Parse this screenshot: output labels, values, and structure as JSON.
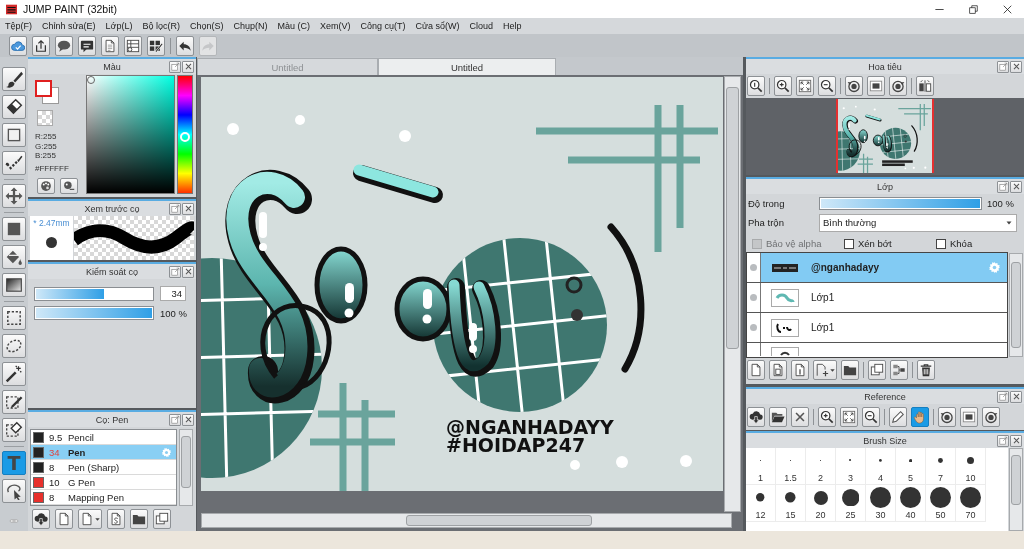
{
  "window": {
    "title": "JUMP PAINT (32bit)"
  },
  "menu": [
    "Tệp(F)",
    "Chỉnh sửa(E)",
    "Lớp(L)",
    "Bộ lọc(R)",
    "Chọn(S)",
    "Chụp(N)",
    "Màu (C)",
    "Xem(V)",
    "Công cụ(T)",
    "Cửa sổ(W)",
    "Cloud",
    "Help"
  ],
  "toolbar": [
    [
      {
        "disabled": false
      },
      {
        "disabled": false
      },
      {
        "disabled": false
      },
      {
        "disabled": false
      },
      {
        "disabled": false
      },
      {
        "disabled": false
      },
      {
        "disabled": false
      }
    ],
    [
      {
        "disabled": false
      },
      {
        "disabled": true
      }
    ]
  ],
  "tools": [
    [
      {
        "selected": false
      },
      {
        "selected": false
      },
      {
        "selected": false
      },
      {
        "selected": false
      }
    ],
    [
      {
        "selected": false
      }
    ],
    [
      {
        "selected": false
      },
      {
        "selected": false
      },
      {
        "selected": false
      }
    ],
    [
      {
        "selected": false
      },
      {
        "selected": false
      },
      {
        "selected": false
      },
      {
        "selected": false
      },
      {
        "selected": false
      }
    ],
    [
      {
        "selected": true,
        "glyph": "T"
      },
      {
        "selected": false
      }
    ]
  ],
  "color_panel": {
    "title": "Màu",
    "channels": [
      "R:255",
      "G:255",
      "B:255"
    ],
    "hex": "#FFFFFF",
    "hue_slider": {
      "level": 0.52
    }
  },
  "brush_preview": {
    "title": "Xem trước cọ",
    "size": "* 2.47mm"
  },
  "brush_control": {
    "title": "Kiểm soát cọ",
    "size_slider": {
      "level": 0.59,
      "reading": "34"
    },
    "opacity_slider": {
      "level": 1,
      "reading": "100 %"
    }
  },
  "brush_list": {
    "title": "Cọ: Pen",
    "brushes": [
      {
        "color": "#222222",
        "size": "9.5",
        "name": "Pencil",
        "selected": false
      },
      {
        "color": "#222222",
        "size": "34",
        "name": "Pen",
        "selected": true
      },
      {
        "color": "#222222",
        "size": "8",
        "name": "Pen (Sharp)",
        "selected": false
      },
      {
        "color": "#e8302c",
        "size": "10",
        "name": "G Pen",
        "selected": false
      },
      {
        "color": "#e8302c",
        "size": "8",
        "name": "Mapping Pen",
        "selected": false
      }
    ]
  },
  "document_tabs": [
    {
      "label": "Untitled",
      "selected": false
    },
    {
      "label": "Untitled",
      "selected": true
    }
  ],
  "canvas": {
    "artwork_text": [
      "@NGANHADAYY",
      "#HOIDAP247"
    ]
  },
  "navigator": {
    "title": "Hoa tiêu"
  },
  "layers": {
    "title": "Lớp",
    "opacity": {
      "label": "Độ trong",
      "level": 1,
      "reading": "100 %"
    },
    "blend": {
      "label": "Pha trộn",
      "value": "Bình thường"
    },
    "options": [
      {
        "label": "Bảo vệ alpha",
        "checked": false,
        "disabled": true
      },
      {
        "label": "Xén bớt",
        "checked": false,
        "disabled": false
      },
      {
        "label": "Khóa",
        "checked": false,
        "disabled": false
      }
    ],
    "items": [
      {
        "name": "@nganhadayy",
        "selected": true
      },
      {
        "name": "Lớp1",
        "selected": false
      },
      {
        "name": "Lớp1",
        "selected": false
      },
      {
        "selected": false
      }
    ]
  },
  "reference": {
    "title": "Reference",
    "tools": [
      [
        {
          "selected": false
        },
        {
          "selected": false
        },
        {
          "selected": false
        }
      ],
      [
        {
          "selected": false
        },
        {
          "selected": false
        },
        {
          "selected": false
        }
      ],
      [
        {
          "selected": false
        },
        {
          "selected": true
        }
      ],
      [
        {
          "selected": false
        },
        {
          "selected": false
        },
        {
          "selected": false
        }
      ]
    ]
  },
  "brush_sizes": {
    "title": "Brush Size",
    "sizes": [
      "1",
      "1.5",
      "2",
      "3",
      "4",
      "5",
      "7",
      "10",
      "12",
      "15",
      "20",
      "25",
      "30",
      "40",
      "50",
      "70"
    ]
  }
}
